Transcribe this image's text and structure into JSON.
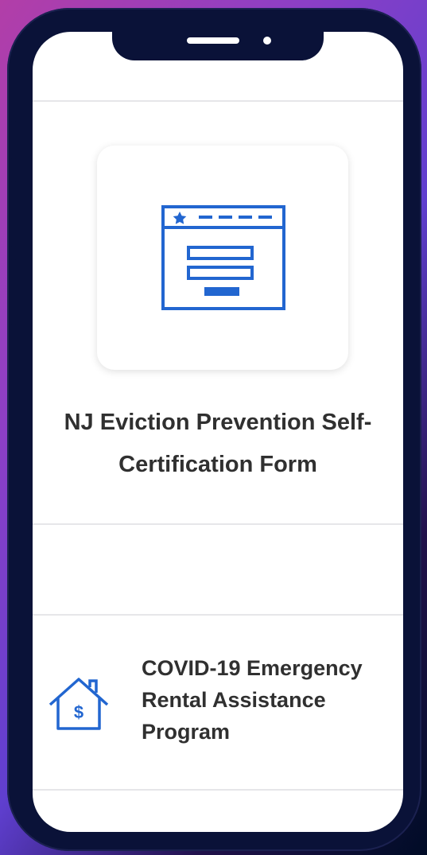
{
  "form_link": {
    "icon": "web-form-icon",
    "title_line1": "NJ Eviction Prevention Self-",
    "title_line2": "Certification Form"
  },
  "program_link": {
    "icon": "house-dollar-icon",
    "title_line1": "COVID-19 Emergency",
    "title_line2": "Rental Assistance",
    "title_line3": "Program"
  },
  "colors": {
    "icon_blue": "#2266d0",
    "text": "#303030",
    "phone_frame": "#0a1238",
    "divider": "#e6e6e9"
  }
}
